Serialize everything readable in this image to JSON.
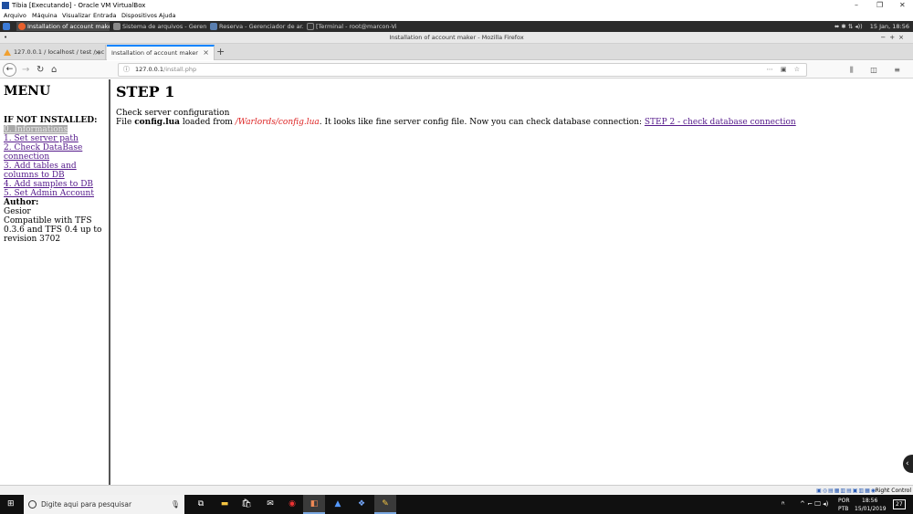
{
  "vbox": {
    "title": "Tibia [Executando] - Oracle VM VirtualBox",
    "menu": [
      "Arquivo",
      "Máquina",
      "Visualizar",
      "Entrada",
      "Dispositivos",
      "Ajuda"
    ]
  },
  "guest_taskbar": {
    "tasks": [
      "Installation of account make...",
      "Sistema de arquivos - Geren...",
      "Reserva - Gerenciador de ar...",
      "[Terminal - root@marcon-Vir..."
    ],
    "clock": "15 Jan, 18:56"
  },
  "firefox": {
    "window_title": "Installation of account maker - Mozilla Firefox",
    "tabs": [
      {
        "label": "127.0.0.1 / localhost / test / ac"
      },
      {
        "label": "Installation of account maker"
      }
    ],
    "url_host": "127.0.0.1",
    "url_path": "/install.php"
  },
  "menu": {
    "title": "MENU",
    "subtitle": "IF NOT INSTALLED:",
    "items": [
      "0. Informations",
      "1. Set server path",
      "2. Check DataBase connection",
      "3. Add tables and columns to DB",
      "4. Add samples to DB",
      "5. Set Admin Account"
    ],
    "author_label": "Author:",
    "author_name": "Gesior",
    "compat": "Compatible with TFS 0.3.6 and TFS 0.4 up to revision 3702"
  },
  "main": {
    "heading": "STEP 1",
    "line1": "Check server configuration",
    "file_prefix": "File ",
    "file_name": "config.lua",
    "loaded_from": " loaded from ",
    "path": "/Warlords/config.lua",
    "message": ". It looks like fine server config file. Now you can check database connection: ",
    "next_link": "STEP 2 - check database connection"
  },
  "vbox_status": {
    "host_key": "Right Control"
  },
  "windows": {
    "search_placeholder": "Digite aqui para pesquisar",
    "lang_top": "POR",
    "lang_bottom": "PTB",
    "time": "18:56",
    "date": "15/01/2019",
    "notifications": "27"
  }
}
